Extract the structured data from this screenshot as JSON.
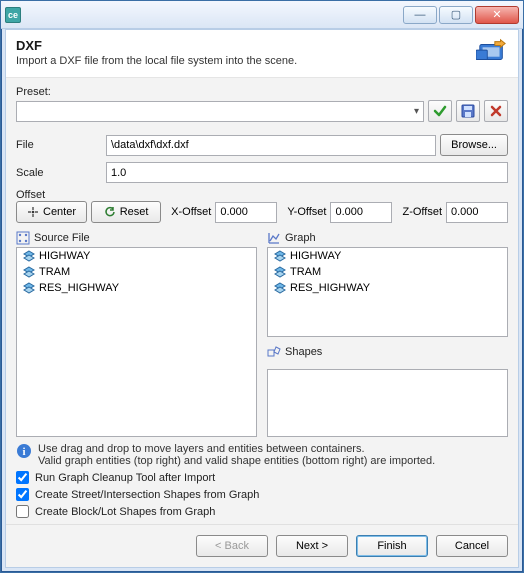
{
  "window": {
    "app_icon_label": "ce",
    "min": "—",
    "max": "▢",
    "close": "✕"
  },
  "header": {
    "title": "DXF",
    "description": "Import a DXF file from the local file system into the scene."
  },
  "preset": {
    "label": "Preset:",
    "value": ""
  },
  "file": {
    "label": "File",
    "value": "\\data\\dxf\\dxf.dxf",
    "browse": "Browse..."
  },
  "scale": {
    "label": "Scale",
    "value": "1.0"
  },
  "offset": {
    "label": "Offset",
    "center": "Center",
    "reset": "Reset",
    "x_label": "X-Offset",
    "x_value": "0.000",
    "y_label": "Y-Offset",
    "y_value": "0.000",
    "z_label": "Z-Offset",
    "z_value": "0.000"
  },
  "source": {
    "title": "Source File",
    "items": [
      "HIGHWAY",
      "TRAM",
      "RES_HIGHWAY"
    ]
  },
  "graph": {
    "title": "Graph",
    "items": [
      "HIGHWAY",
      "TRAM",
      "RES_HIGHWAY"
    ]
  },
  "shapes": {
    "title": "Shapes",
    "items": []
  },
  "info": {
    "line1": "Use drag and drop to move layers and entities between containers.",
    "line2": "Valid graph entities (top right) and valid shape entities (bottom right) are imported."
  },
  "options": {
    "cleanup": {
      "label": "Run Graph Cleanup Tool after Import",
      "checked": true
    },
    "streets": {
      "label": "Create Street/Intersection Shapes from Graph",
      "checked": true
    },
    "blocks": {
      "label": "Create Block/Lot Shapes from Graph",
      "checked": false
    }
  },
  "footer": {
    "back": "< Back",
    "next": "Next >",
    "finish": "Finish",
    "cancel": "Cancel"
  }
}
